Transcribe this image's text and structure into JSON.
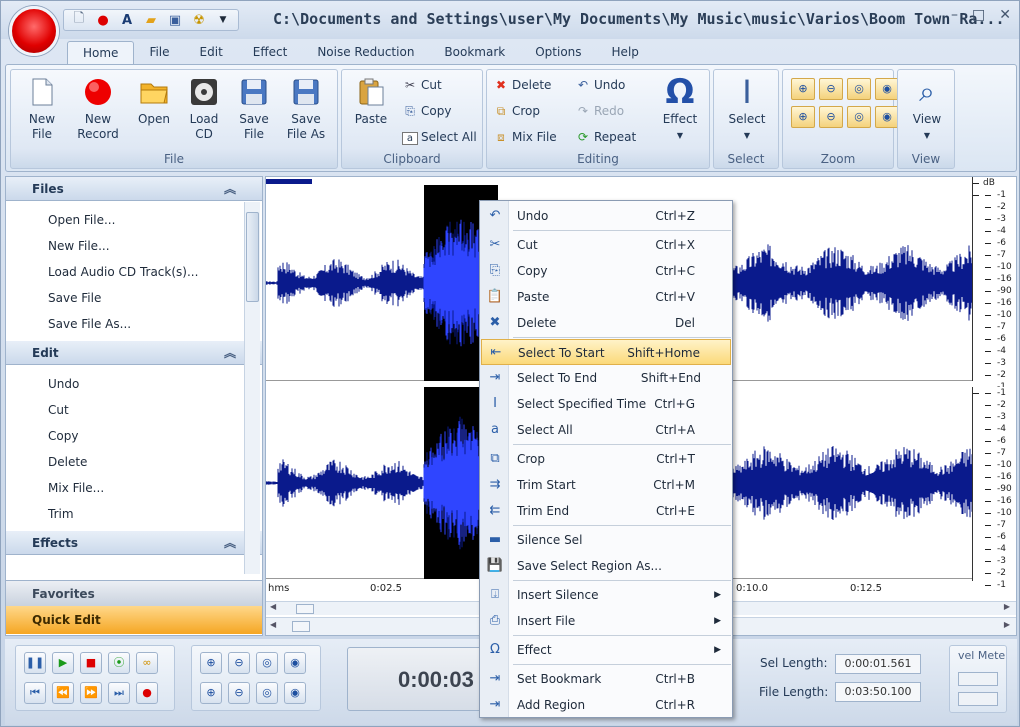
{
  "window": {
    "title": "C:\\Documents and Settings\\user\\My Documents\\My Music\\music\\Varios\\Boom Town Ra...",
    "qat_icons": [
      "new-file-icon",
      "record-icon",
      "text-icon",
      "open-folder-icon",
      "save-icon",
      "radioactive-icon",
      "dropdown-icon"
    ],
    "minimize": "–",
    "maximize": "□",
    "close": "✕"
  },
  "tabs": [
    "Home",
    "File",
    "Edit",
    "Effect",
    "Noise Reduction",
    "Bookmark",
    "Options",
    "Help"
  ],
  "ribbon": {
    "file": {
      "label": "File",
      "buttons": [
        {
          "l1": "New",
          "l2": "File"
        },
        {
          "l1": "New",
          "l2": "Record"
        },
        {
          "l1": "Open",
          "l2": ""
        },
        {
          "l1": "Load",
          "l2": "CD"
        },
        {
          "l1": "Save",
          "l2": "File"
        },
        {
          "l1": "Save",
          "l2": "File As"
        }
      ]
    },
    "clipboard": {
      "label": "Clipboard",
      "paste": "Paste",
      "cut": "Cut",
      "copy": "Copy",
      "select_all": "Select All"
    },
    "editing": {
      "label": "Editing",
      "delete": "Delete",
      "crop": "Crop",
      "mix_file": "Mix File",
      "undo": "Undo",
      "redo": "Redo",
      "repeat": "Repeat",
      "effect": "Effect"
    },
    "select": {
      "label": "Select",
      "button": "Select"
    },
    "zoom": {
      "label": "Zoom"
    },
    "view": {
      "label": "View",
      "button": "View"
    }
  },
  "left_panel": {
    "files": {
      "title": "Files",
      "items": [
        "Open File...",
        "New File...",
        "Load Audio CD Track(s)...",
        "Save File",
        "Save File As..."
      ]
    },
    "edit": {
      "title": "Edit",
      "items": [
        "Undo",
        "Cut",
        "Copy",
        "Delete",
        "Mix File...",
        "Trim"
      ]
    },
    "effects": {
      "title": "Effects"
    },
    "favorites": "Favorites",
    "quick_edit": "Quick Edit"
  },
  "waveform": {
    "db_label": "dB",
    "ruler_top": [
      "-1",
      "-2",
      "-3",
      "-4",
      "-6",
      "-7",
      "-10",
      "-16",
      "-90",
      "-16",
      "-10",
      "-7",
      "-6",
      "-4",
      "-3",
      "-2",
      "-1"
    ],
    "ruler_bottom": [
      "-1",
      "-2",
      "-3",
      "-4",
      "-6",
      "-7",
      "-10",
      "-16",
      "-90",
      "-16",
      "-10",
      "-7",
      "-6",
      "-4",
      "-3",
      "-2",
      "-1"
    ],
    "timeline": [
      "hms",
      "0:02.5",
      "0:10.0",
      "0:12.5"
    ],
    "wave_color": "#0a1a8c",
    "selection_color": "#000000"
  },
  "context_menu": {
    "items": [
      {
        "label": "Undo",
        "shortcut": "Ctrl+Z",
        "icon": "undo-icon",
        "glyph": "↶"
      },
      {
        "label": "Cut",
        "shortcut": "Ctrl+X",
        "icon": "scissors-icon",
        "glyph": "✂"
      },
      {
        "label": "Copy",
        "shortcut": "Ctrl+C",
        "icon": "copy-icon",
        "glyph": "⎘"
      },
      {
        "label": "Paste",
        "shortcut": "Ctrl+V",
        "icon": "paste-icon",
        "glyph": "📋"
      },
      {
        "label": "Delete",
        "shortcut": "Del",
        "icon": "delete-icon",
        "glyph": "✖"
      },
      {
        "label": "Select To Start",
        "shortcut": "Shift+Home",
        "icon": "select-start-icon",
        "glyph": "⇤"
      },
      {
        "label": "Select To End",
        "shortcut": "Shift+End",
        "icon": "select-end-icon",
        "glyph": "⇥"
      },
      {
        "label": "Select Specified Time",
        "shortcut": "Ctrl+G",
        "icon": "select-time-icon",
        "glyph": "Ⅰ"
      },
      {
        "label": "Select All",
        "shortcut": "Ctrl+A",
        "icon": "select-all-icon",
        "glyph": "a"
      },
      {
        "label": "Crop",
        "shortcut": "Ctrl+T",
        "icon": "crop-icon",
        "glyph": "⧉"
      },
      {
        "label": "Trim Start",
        "shortcut": "Ctrl+M",
        "icon": "trim-start-icon",
        "glyph": "⇉"
      },
      {
        "label": "Trim End",
        "shortcut": "Ctrl+E",
        "icon": "trim-end-icon",
        "glyph": "⇇"
      },
      {
        "label": "Silence Sel",
        "shortcut": "",
        "icon": "silence-icon",
        "glyph": "▬"
      },
      {
        "label": "Save Select Region As...",
        "shortcut": "",
        "icon": "save-region-icon",
        "glyph": "💾"
      },
      {
        "label": "Insert Silence",
        "shortcut": "",
        "icon": "insert-silence-icon",
        "glyph": "⍗",
        "submenu": true
      },
      {
        "label": "Insert File",
        "shortcut": "",
        "icon": "insert-file-icon",
        "glyph": "⎙",
        "submenu": true
      },
      {
        "label": "Effect",
        "shortcut": "",
        "icon": "omega-icon",
        "glyph": "Ω",
        "submenu": true
      },
      {
        "label": "Set Bookmark",
        "shortcut": "Ctrl+B",
        "icon": "bookmark-icon",
        "glyph": "⇥"
      },
      {
        "label": "Add Region",
        "shortcut": "Ctrl+R",
        "icon": "region-icon",
        "glyph": "⇥"
      }
    ],
    "highlighted_index": 5
  },
  "transport": {
    "time": "0:00:03",
    "sel_length_label": "Sel Length:",
    "sel_length_value": "0:00:01.561",
    "file_length_label": "File Length:",
    "file_length_value": "0:03:50.100",
    "level_meter_label": "vel Mete"
  }
}
